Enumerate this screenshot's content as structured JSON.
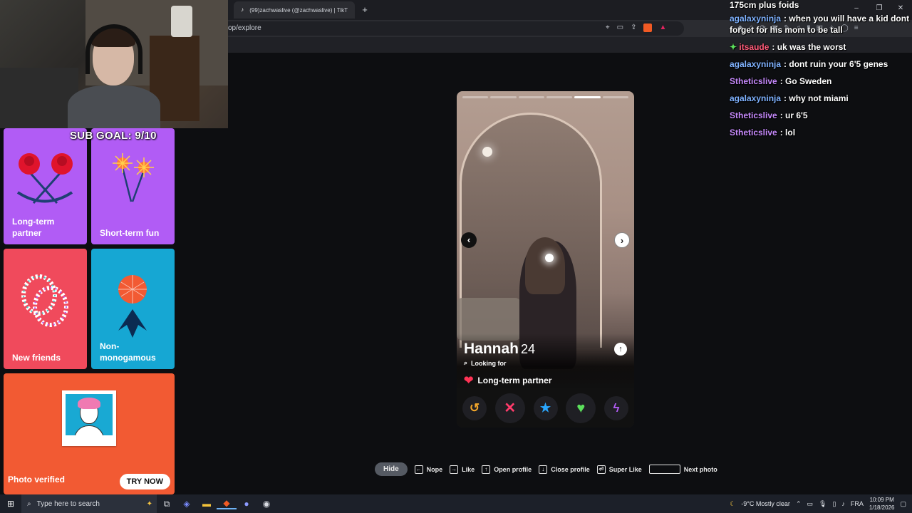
{
  "browser": {
    "tab_title": "(99)zachwaslive (@zachwaslive) | TikT",
    "new_tab": "+",
    "url": "op/explore"
  },
  "overlay": {
    "sub_goal": "SUB GOAL: 9/10"
  },
  "tiles": [
    {
      "label": "Long-term partner",
      "color": "#b15cf5"
    },
    {
      "label": "Short-term fun",
      "color": "#b15cf5"
    },
    {
      "label": "New friends",
      "color": "#f04a5c"
    },
    {
      "label": "Non-monogamous",
      "color": "#16a7d3"
    },
    {
      "label": "Photo verified",
      "color": "#f25a33",
      "button": "TRY NOW"
    }
  ],
  "profile": {
    "name": "Hannah",
    "age": "24",
    "looking_for_label": "Looking for",
    "looking_for_value": "Long-term partner",
    "photo_count": 6,
    "active_photo": 5
  },
  "actions": [
    {
      "name": "rewind",
      "glyph": "↺"
    },
    {
      "name": "nope",
      "glyph": "✕"
    },
    {
      "name": "super-like",
      "glyph": "★"
    },
    {
      "name": "like",
      "glyph": "♥"
    },
    {
      "name": "boost",
      "glyph": "ϟ"
    }
  ],
  "hints": {
    "hide": "Hide",
    "nope": "Nope",
    "like": "Like",
    "open_profile": "Open profile",
    "close_profile": "Close profile",
    "super_like": "Super Like",
    "next_photo": "Next photo"
  },
  "chat": {
    "first_line": "175cm plus foids",
    "messages": [
      {
        "user": "agalaxyninja",
        "text": ": when you will have a kid dont forget for his mom to be tall",
        "color": "#7fb2ff"
      },
      {
        "user": "itsaude",
        "text": ": uk was the worst",
        "color": "#ff5c7a"
      },
      {
        "user": "agalaxyninja",
        "text": ": dont ruin your 6'5 genes",
        "color": "#7fb2ff"
      },
      {
        "user": "Stheticslive",
        "text": ": Go Sweden",
        "color": "#c88bff"
      },
      {
        "user": "agalaxyninja",
        "text": ": why not miami",
        "color": "#7fb2ff"
      },
      {
        "user": "Stheticslive",
        "text": ": ur 6'5",
        "color": "#c88bff"
      },
      {
        "user": "Stheticslive",
        "text": ": lol",
        "color": "#c88bff"
      }
    ]
  },
  "taskbar": {
    "search_placeholder": "Type here to search",
    "weather": "-9°C  Mostly clear",
    "language": "FRA",
    "time": "10:09 PM",
    "date": "1/18/2026"
  }
}
